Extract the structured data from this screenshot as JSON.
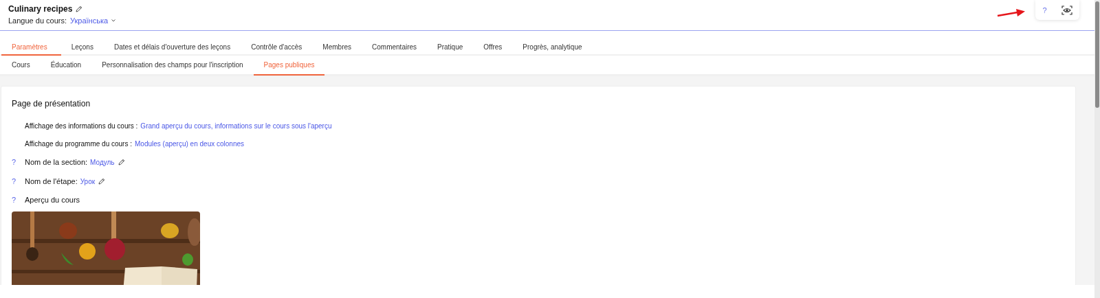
{
  "course": {
    "title": "Culinary recipes",
    "language_label": "Langue du cours:",
    "language": "Українська"
  },
  "toolbar": {
    "help": "?"
  },
  "tabs": [
    {
      "label": "Paramètres",
      "selected": true
    },
    {
      "label": "Leçons",
      "selected": false
    },
    {
      "label": "Dates et délais d'ouverture des leçons",
      "selected": false
    },
    {
      "label": "Contrôle d'accès",
      "selected": false
    },
    {
      "label": "Membres",
      "selected": false
    },
    {
      "label": "Commentaires",
      "selected": false
    },
    {
      "label": "Pratique",
      "selected": false
    },
    {
      "label": "Offres",
      "selected": false
    },
    {
      "label": "Progrès, analytique",
      "selected": false
    }
  ],
  "subtabs": [
    {
      "label": "Cours",
      "selected": false
    },
    {
      "label": "Éducation",
      "selected": false
    },
    {
      "label": "Personnalisation des champs pour l'inscription",
      "selected": false
    },
    {
      "label": "Pages publiques",
      "selected": true
    }
  ],
  "section": {
    "title": "Page de présentation",
    "settings": [
      {
        "kind": "link",
        "label": "Affichage des informations du cours :",
        "value": "Grand aperçu du cours, informations sur le cours sous l'aperçu"
      },
      {
        "kind": "link",
        "label": "Affichage du programme du cours :",
        "value": "Modules (aperçu) en deux colonnes"
      },
      {
        "kind": "editable",
        "help": "?",
        "label": "Nom de la section:",
        "value": "Модуль"
      },
      {
        "kind": "editable",
        "help": "?",
        "label": "Nom de l'étape:",
        "value": "Урок"
      },
      {
        "kind": "title",
        "help": "?",
        "label": "Aperçu du cours"
      }
    ]
  }
}
